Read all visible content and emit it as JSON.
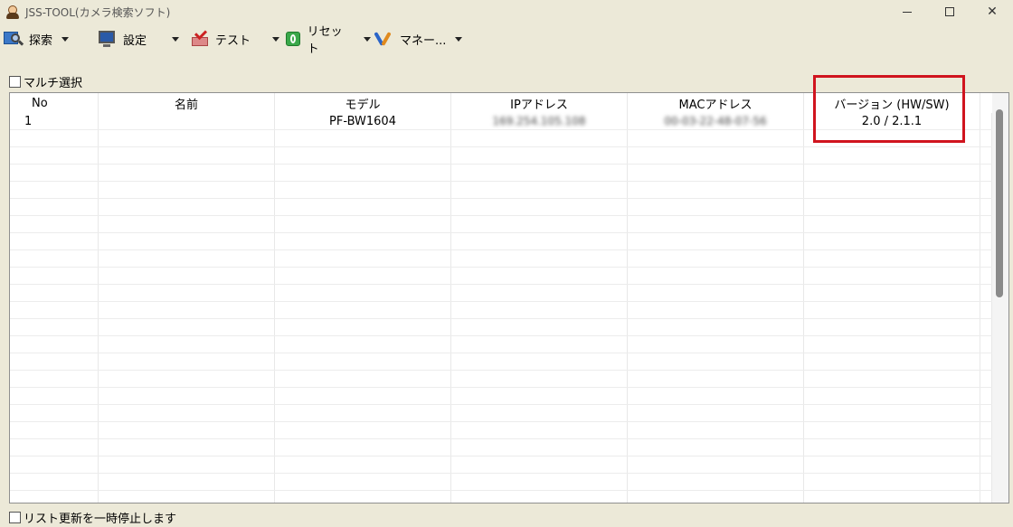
{
  "window": {
    "title": "JSS-TOOL(カメラ検索ソフト)",
    "controls": {
      "minimize": "minimize",
      "maximize": "maximize",
      "close": "✕"
    }
  },
  "toolbar": {
    "search_label": "探索",
    "settings_label": "設定",
    "test_label": "テスト",
    "reset_label": "リセット",
    "manage_label": "マネー..."
  },
  "multi_select": {
    "label": "マルチ選択",
    "checked": false
  },
  "table": {
    "columns": [
      "No",
      "名前",
      "モデル",
      "IPアドレス",
      "MACアドレス",
      "バージョン (HW/SW)"
    ],
    "rows": [
      {
        "no": "1",
        "name": "",
        "model": "PF-BW1604",
        "ip": "169.254.105.108",
        "mac": "00-03-22-48-07-56",
        "version": "2.0 / 2.1.1"
      }
    ]
  },
  "pause_update": {
    "label": "リスト更新を一時停止します",
    "checked": false
  },
  "colors": {
    "highlight": "#d0141e",
    "background": "#ece9d8"
  }
}
